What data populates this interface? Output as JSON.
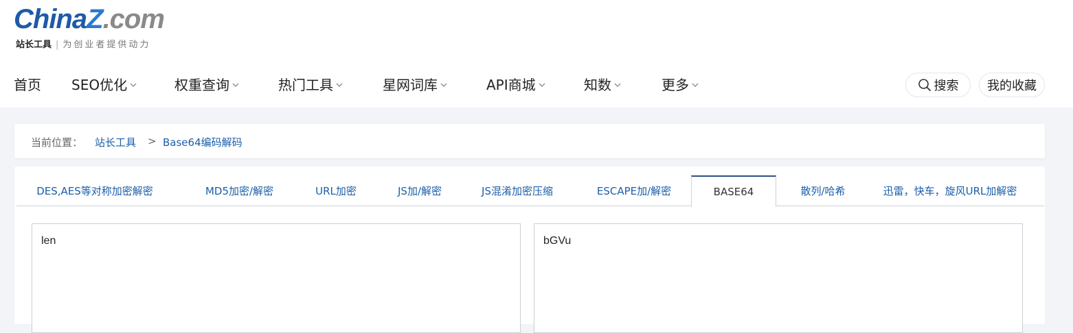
{
  "logo": {
    "word_a": "China",
    "word_b": "Z",
    "word_c": ".com",
    "tagline_strong": "站长工具",
    "tagline_sep": "|",
    "tagline_slogan": "为创业者提供动力"
  },
  "nav": {
    "items": [
      {
        "label": "首页",
        "dropdown": false
      },
      {
        "label": "SEO优化",
        "dropdown": true
      },
      {
        "label": "权重查询",
        "dropdown": true
      },
      {
        "label": "热门工具",
        "dropdown": true
      },
      {
        "label": "星网词库",
        "dropdown": true
      },
      {
        "label": "API商城",
        "dropdown": true
      },
      {
        "label": "知数",
        "dropdown": true
      },
      {
        "label": "更多",
        "dropdown": true
      }
    ],
    "search_label": "搜索",
    "favorites_label": "我的收藏"
  },
  "breadcrumb": {
    "prefix": "当前位置：",
    "items": [
      "站长工具",
      "Base64编码解码"
    ],
    "separator": ">"
  },
  "tabs": {
    "items": [
      "DES,AES等对称加密解密",
      "MD5加密/解密",
      "URL加密",
      "JS加/解密",
      "JS混淆加密压缩",
      "ESCAPE加/解密",
      "BASE64",
      "散列/哈希",
      "迅雷，快车，旋风URL加解密"
    ],
    "active": "BASE64"
  },
  "editor": {
    "input_value": "len",
    "output_value": "bGVu"
  },
  "colors": {
    "link": "#1a5ea8",
    "active_tab_top": "#2c4f86",
    "page_bg": "#f2f4f7"
  }
}
